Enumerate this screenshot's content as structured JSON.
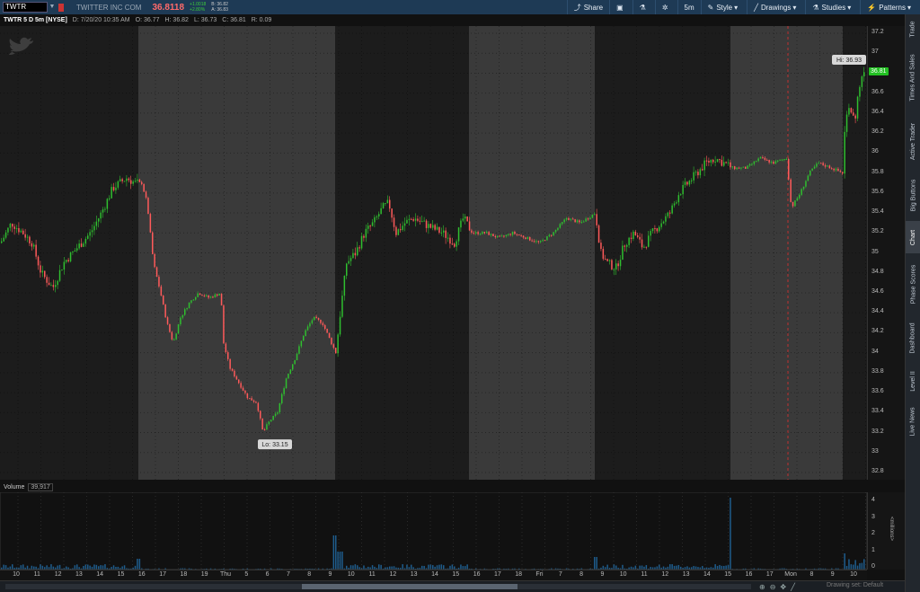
{
  "toolbar": {
    "symbol": "TWTR",
    "company": "TWITTER INC COM",
    "last_price": "36.8118",
    "net_change": "+1.0018",
    "pct_change": "+2.80%",
    "bid": "B: 36.82",
    "ask": "A: 36.83",
    "share": "Share",
    "interval": "5m",
    "style": "Style",
    "drawings": "Drawings",
    "studies": "Studies",
    "patterns": "Patterns"
  },
  "chart_header": {
    "title": "TWTR 5 D 5m [NYSE]",
    "date": "D: 7/20/20 10:35 AM",
    "open": "O: 36.77",
    "high": "H: 36.82",
    "low": "L: 36.73",
    "close": "C: 36.81",
    "range": "R: 0.09"
  },
  "side_tabs": [
    "Trade",
    "Times And Sales",
    "Active Trader",
    "Big Buttons",
    "Chart",
    "Phase Scores",
    "Dashboard",
    "Level II",
    "Live News"
  ],
  "volume": {
    "label": "Volume",
    "value": "39,917",
    "units": "<millions>"
  },
  "annotations": {
    "hi": "Hi: 36.93",
    "lo": "Lo: 33.15",
    "current": "36.81"
  },
  "bottom": {
    "drawing_set": "Drawing set: Default"
  },
  "colors": {
    "up": "#2fbf2f",
    "down": "#ff5a5a",
    "extended_bg": "#3a3a3a",
    "regular_bg": "#1c1c1c",
    "volume": "#1e5c8c"
  },
  "chart_data": {
    "type": "candlestick",
    "title": "TWTR 5 D 5m [NYSE]",
    "ylim": [
      32.8,
      37.2
    ],
    "price_ticks": [
      "37.2",
      "37",
      "36.8",
      "36.6",
      "36.4",
      "36.2",
      "36",
      "35.8",
      "35.6",
      "35.4",
      "35.2",
      "35",
      "34.8",
      "34.6",
      "34.4",
      "34.2",
      "34",
      "33.8",
      "33.6",
      "33.4",
      "33.2",
      "33",
      "32.8"
    ],
    "volume_ticks": [
      "4",
      "3",
      "2",
      "1",
      "0"
    ],
    "time_labels": [
      "10",
      "11",
      "12",
      "13",
      "14",
      "15",
      "16",
      "17",
      "18",
      "19",
      "Thu",
      "5",
      "6",
      "7",
      "8",
      "9",
      "10",
      "11",
      "12",
      "13",
      "14",
      "15",
      "16",
      "17",
      "18",
      "Fri",
      "7",
      "8",
      "9",
      "10",
      "11",
      "12",
      "13",
      "14",
      "15",
      "16",
      "17",
      "Mon",
      "8",
      "9",
      "10"
    ],
    "price_path": [
      [
        0,
        35.1
      ],
      [
        12,
        35.3
      ],
      [
        25,
        35.2
      ],
      [
        35,
        35.1
      ],
      [
        45,
        34.8
      ],
      [
        58,
        34.65
      ],
      [
        70,
        34.9
      ],
      [
        85,
        35.05
      ],
      [
        100,
        35.2
      ],
      [
        112,
        35.4
      ],
      [
        125,
        35.65
      ],
      [
        140,
        35.75
      ],
      [
        150,
        35.7
      ],
      [
        157,
        35.7
      ],
      [
        163,
        35.5
      ],
      [
        170,
        34.9
      ],
      [
        178,
        34.6
      ],
      [
        185,
        34.3
      ],
      [
        192,
        34.1
      ],
      [
        200,
        34.35
      ],
      [
        210,
        34.5
      ],
      [
        220,
        34.6
      ],
      [
        232,
        34.55
      ],
      [
        245,
        34.6
      ],
      [
        248,
        34.1
      ],
      [
        255,
        33.85
      ],
      [
        265,
        33.7
      ],
      [
        275,
        33.55
      ],
      [
        285,
        33.5
      ],
      [
        292,
        33.2
      ],
      [
        298,
        33.3
      ],
      [
        308,
        33.4
      ],
      [
        318,
        33.75
      ],
      [
        328,
        33.95
      ],
      [
        338,
        34.2
      ],
      [
        348,
        34.35
      ],
      [
        358,
        34.3
      ],
      [
        368,
        34.1
      ],
      [
        373,
        34.0
      ],
      [
        378,
        34.4
      ],
      [
        385,
        34.9
      ],
      [
        395,
        35.0
      ],
      [
        405,
        35.2
      ],
      [
        415,
        35.3
      ],
      [
        425,
        35.45
      ],
      [
        432,
        35.5
      ],
      [
        440,
        35.2
      ],
      [
        450,
        35.3
      ],
      [
        460,
        35.35
      ],
      [
        470,
        35.3
      ],
      [
        480,
        35.25
      ],
      [
        492,
        35.2
      ],
      [
        505,
        35.1
      ],
      [
        515,
        35.35
      ],
      [
        525,
        35.2
      ],
      [
        540,
        35.2
      ],
      [
        555,
        35.15
      ],
      [
        570,
        35.2
      ],
      [
        585,
        35.15
      ],
      [
        600,
        35.1
      ],
      [
        615,
        35.2
      ],
      [
        630,
        35.35
      ],
      [
        645,
        35.3
      ],
      [
        662,
        35.4
      ],
      [
        668,
        35.0
      ],
      [
        675,
        34.9
      ],
      [
        685,
        34.85
      ],
      [
        695,
        35.1
      ],
      [
        705,
        35.2
      ],
      [
        715,
        35.05
      ],
      [
        725,
        35.2
      ],
      [
        735,
        35.3
      ],
      [
        745,
        35.4
      ],
      [
        755,
        35.6
      ],
      [
        765,
        35.7
      ],
      [
        775,
        35.8
      ],
      [
        785,
        35.9
      ],
      [
        795,
        35.95
      ],
      [
        805,
        35.9
      ],
      [
        815,
        35.85
      ],
      [
        830,
        35.85
      ],
      [
        845,
        35.95
      ],
      [
        860,
        35.9
      ],
      [
        875,
        35.95
      ],
      [
        880,
        35.45
      ],
      [
        890,
        35.6
      ],
      [
        900,
        35.8
      ],
      [
        910,
        35.9
      ],
      [
        925,
        35.85
      ],
      [
        937,
        35.8
      ],
      [
        940,
        36.3
      ],
      [
        945,
        36.5
      ],
      [
        950,
        36.3
      ],
      [
        955,
        36.6
      ],
      [
        960,
        36.81
      ]
    ],
    "annotations": {
      "high": 36.93,
      "low": 33.15
    }
  }
}
